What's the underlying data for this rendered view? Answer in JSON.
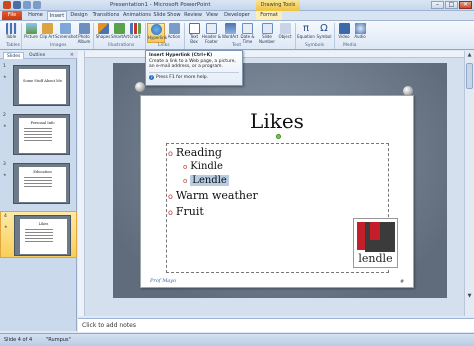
{
  "window": {
    "title": "Presentation1 - Microsoft PowerPoint",
    "contextual_tab": "Drawing Tools",
    "min": "–",
    "max": "□",
    "close": "✕"
  },
  "tabs": [
    "File",
    "Home",
    "Insert",
    "Design",
    "Transitions",
    "Animations",
    "Slide Show",
    "Review",
    "View",
    "Developer",
    "Format"
  ],
  "active_tab": "Insert",
  "ribbon": {
    "buttons": {
      "table": "Table",
      "picture": "Picture",
      "clip_art": "Clip Art",
      "screenshot": "Screenshot",
      "photo_album": "Photo Album",
      "shapes": "Shapes",
      "smartart": "SmartArt",
      "chart": "Chart",
      "hyperlink": "Hyperlink",
      "action": "Action",
      "text_box": "Text Box",
      "header_footer": "Header & Footer",
      "wordart": "WordArt",
      "date_time": "Date & Time",
      "slide_number": "Slide Number",
      "object": "Object",
      "equation": "Equation",
      "symbol": "Symbol",
      "video": "Video",
      "audio": "Audio"
    },
    "groups": {
      "tables": "Tables",
      "images": "Images",
      "illustrations": "Illustrations",
      "links": "Links",
      "text": "Text",
      "symbols": "Symbols",
      "media": "Media"
    }
  },
  "tooltip": {
    "title": "Insert Hyperlink (Ctrl+K)",
    "body": "Create a link to a Web page, a picture, an e-mail address, or a program.",
    "help": "Press F1 for more help."
  },
  "left_pane": {
    "tabs": [
      "Slides",
      "Outline"
    ],
    "close": "×",
    "thumbnails": [
      {
        "num": "1",
        "title": "Some Stuff About Me"
      },
      {
        "num": "2",
        "title": "Personal Info"
      },
      {
        "num": "3",
        "title": "Education"
      },
      {
        "num": "4",
        "title": "Likes"
      }
    ]
  },
  "slide": {
    "title": "Likes",
    "bullets": [
      {
        "level": 1,
        "text": "Reading"
      },
      {
        "level": 2,
        "text": "Kindle"
      },
      {
        "level": 2,
        "text": "Lendle",
        "selected": true
      },
      {
        "level": 1,
        "text": "Warm weather"
      },
      {
        "level": 1,
        "text": "Fruit"
      }
    ],
    "logo_text": "lendle",
    "signature": "Prof Mayo",
    "bullet_glyph": "o"
  },
  "notes": {
    "placeholder": "Click to add notes"
  },
  "status": {
    "slide_info": "Slide 4 of 4",
    "theme": "\"Rumpus\""
  },
  "colors": {
    "accent": "#c41e2a",
    "file_tab": "#c33b10",
    "selection": "#b8cce4"
  }
}
